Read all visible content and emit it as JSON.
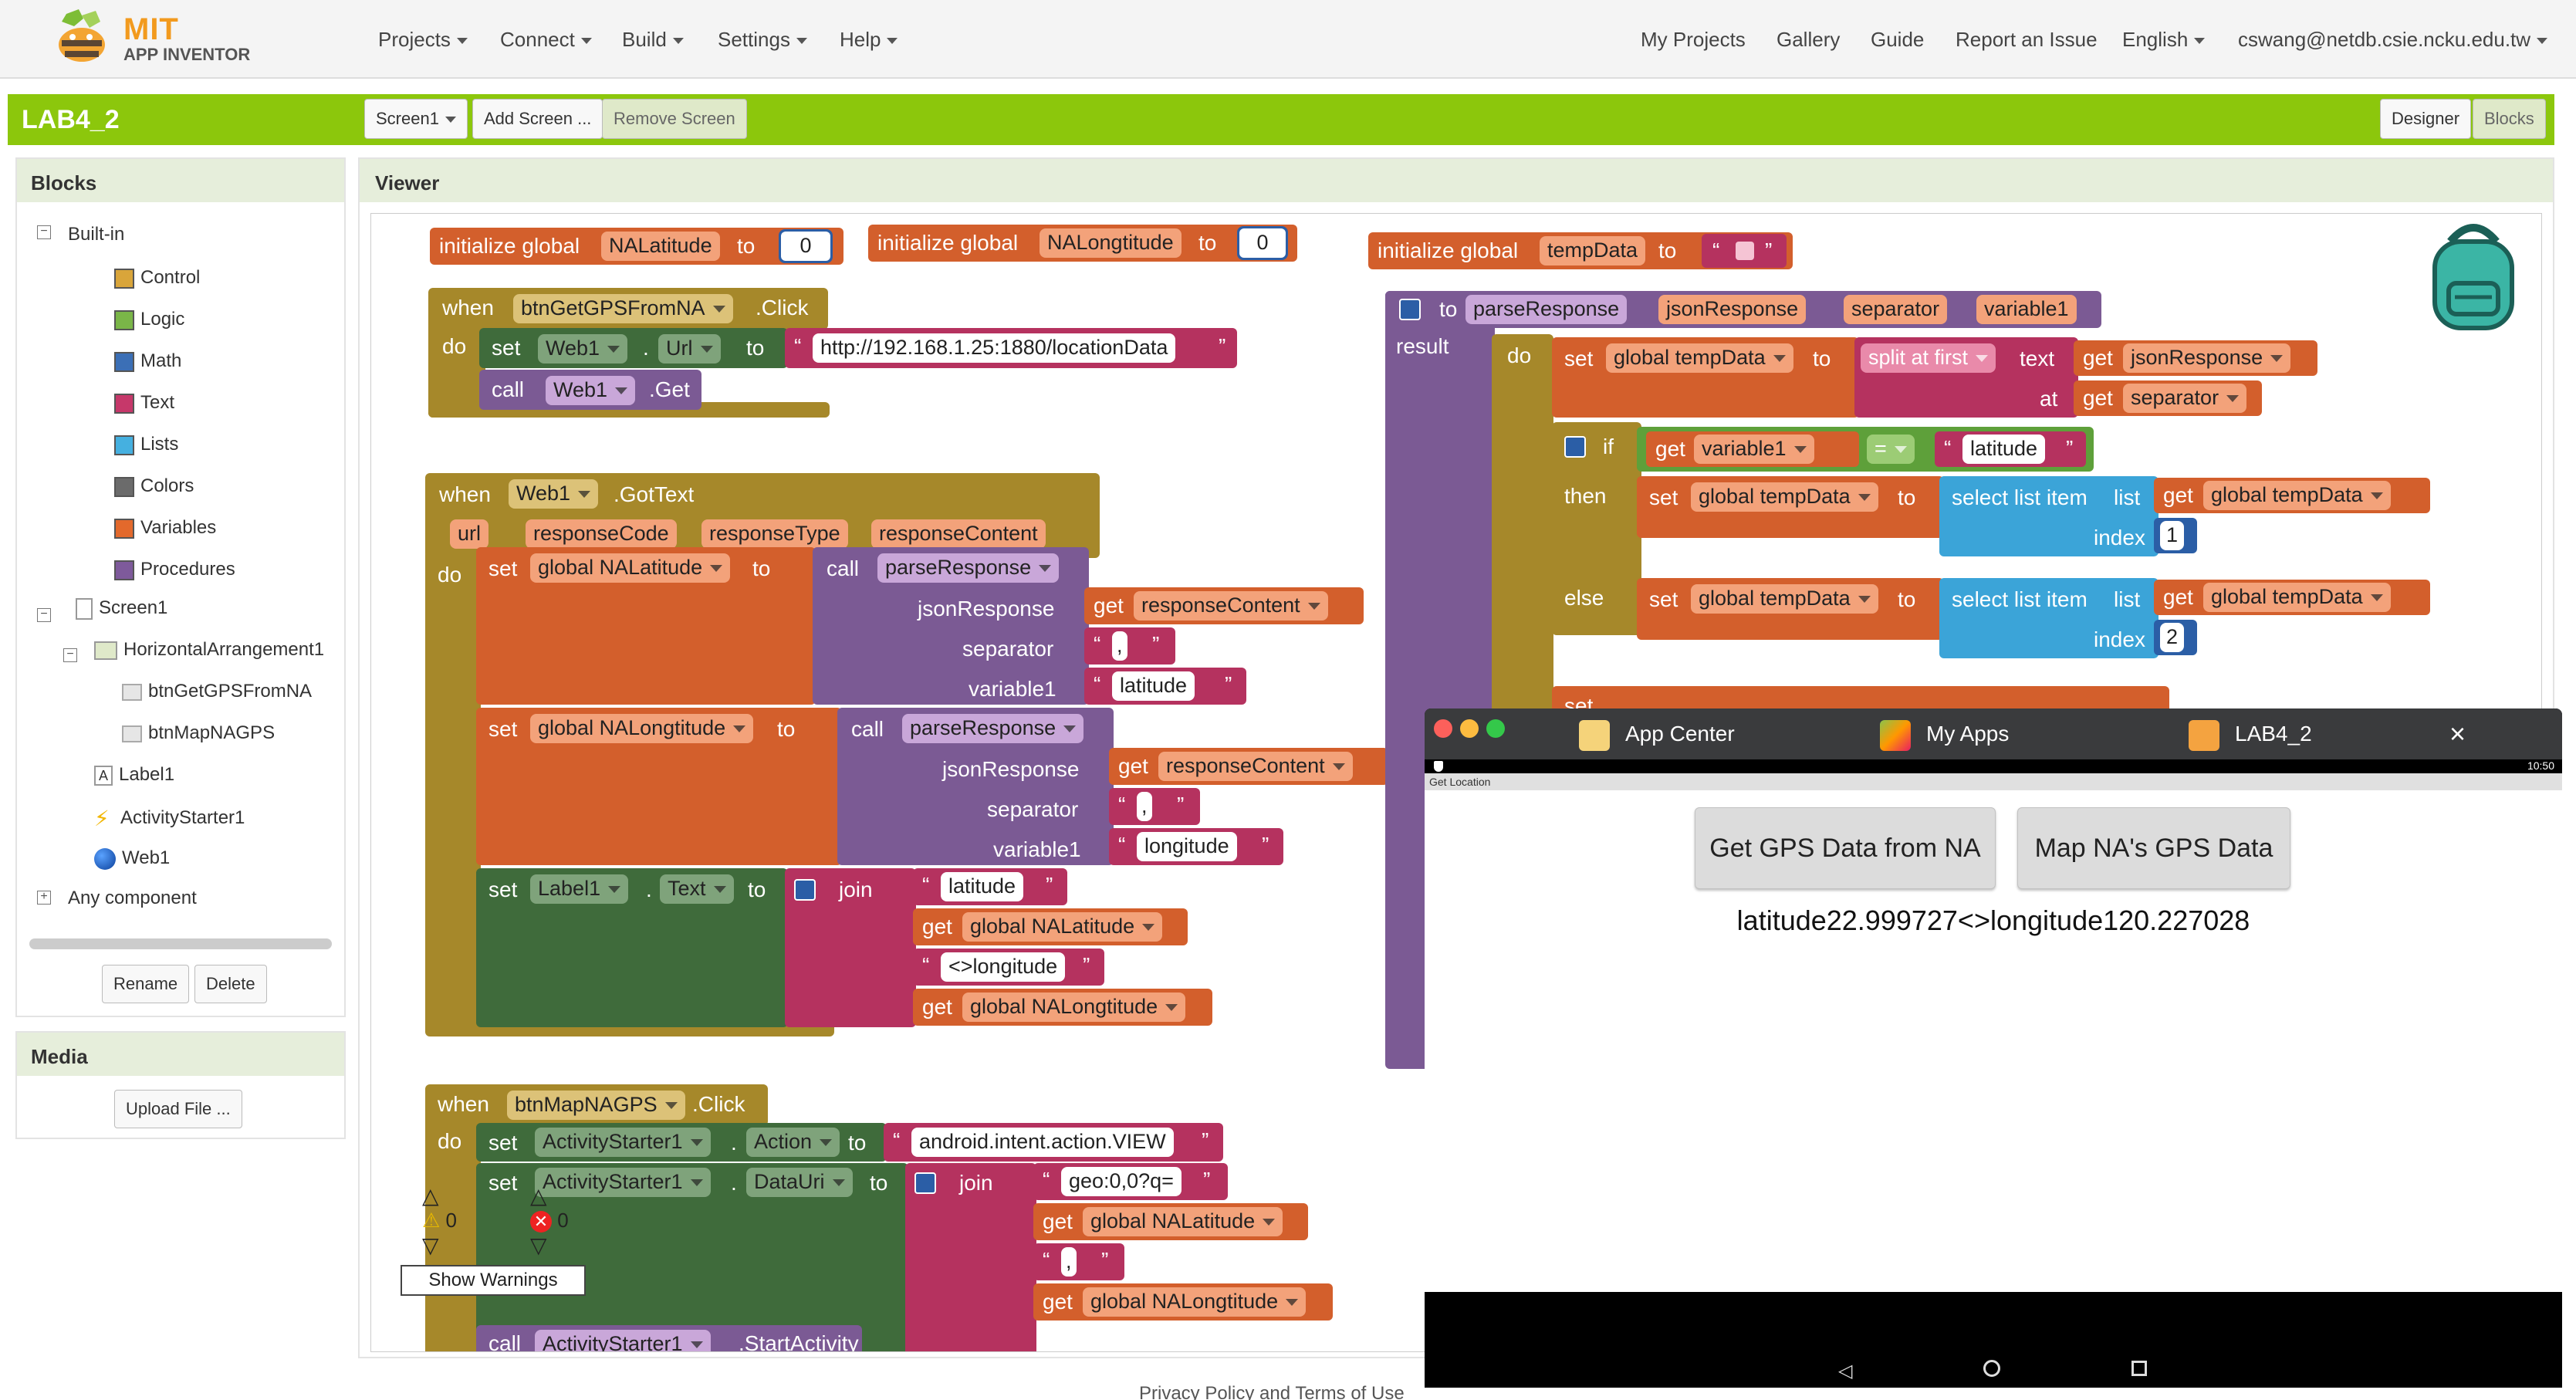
{
  "topnav": {
    "logo_line1": "MIT",
    "logo_line2": "APP INVENTOR",
    "menus": [
      "Projects",
      "Connect",
      "Build",
      "Settings",
      "Help"
    ],
    "right_links": [
      "My Projects",
      "Gallery",
      "Guide",
      "Report an Issue"
    ],
    "language": "English",
    "user": "cswang@netdb.csie.ncku.edu.tw"
  },
  "project": {
    "name": "LAB4_2",
    "screen_select": "Screen1",
    "add_screen": "Add Screen ...",
    "remove_screen": "Remove Screen",
    "designer": "Designer",
    "blocks": "Blocks"
  },
  "blocks_panel": {
    "title": "Blocks",
    "builtin": "Built-in",
    "categories": [
      {
        "label": "Control",
        "color": "#d9a53a"
      },
      {
        "label": "Logic",
        "color": "#7ab648"
      },
      {
        "label": "Math",
        "color": "#3b6fb6"
      },
      {
        "label": "Text",
        "color": "#c6386a"
      },
      {
        "label": "Lists",
        "color": "#45b0e0"
      },
      {
        "label": "Colors",
        "color": "#6b6b6b"
      },
      {
        "label": "Variables",
        "color": "#e3692c"
      },
      {
        "label": "Procedures",
        "color": "#7e5a9b"
      }
    ],
    "screen": "Screen1",
    "arrangement": "HorizontalArrangement1",
    "buttons": [
      "btnGetGPSFromNA",
      "btnMapNAGPS"
    ],
    "label": "Label1",
    "starter": "ActivityStarter1",
    "web": "Web1",
    "any": "Any component",
    "rename": "Rename",
    "delete": "Delete"
  },
  "media": {
    "title": "Media",
    "upload": "Upload File ..."
  },
  "viewer": {
    "title": "Viewer",
    "warnings_count": "0",
    "errors_count": "0",
    "show_warnings": "Show Warnings",
    "footer": "Privacy Policy and Terms of Use"
  },
  "blocks": {
    "init_global": "initialize global",
    "to": "to",
    "var_lat": "NALatitude",
    "var_lng": "NALongtitude",
    "var_temp": "tempData",
    "zero": "0",
    "when": "when",
    "do": "do",
    "set": "set",
    "call": "call",
    "get": "get",
    "btn_gps": "btnGetGPSFromNA",
    "click": ".Click",
    "web1": "Web1",
    "url_prop": "Url",
    "url_value": "http://192.168.1.25:1880/locationData",
    "get_method": ".Get",
    "gottext": ".GotText",
    "params": [
      "url",
      "responseCode",
      "responseType",
      "responseContent"
    ],
    "global_lat": "global NALatitude",
    "global_lng": "global NALongtitude",
    "global_temp": "global tempData",
    "parse": "parseResponse",
    "json_response": "jsonResponse",
    "separator": "separator",
    "variable1": "variable1",
    "response_content": "responseContent",
    "comma": ",",
    "latitude": "latitude",
    "longitude": "longitude",
    "label1": "Label1",
    "text_prop": "Text",
    "join": "join",
    "sep_lng": "<>longitude",
    "btn_map": "btnMapNAGPS",
    "starter": "ActivityStarter1",
    "action_prop": "Action",
    "action_value": "android.intent.action.VIEW",
    "datauri_prop": "DataUri",
    "geo_value": "geo:0,0?q=",
    "start_activity": ".StartActivity",
    "result": "result",
    "split_first": "split at first",
    "text_word": "text",
    "at_word": "at",
    "if_word": "if",
    "then_word": "then",
    "else_word": "else",
    "eq": "=",
    "select_item": "select list item",
    "list_word": "list",
    "index_word": "index",
    "one": "1",
    "two": "2"
  },
  "emulator": {
    "tabs": [
      "App Center",
      "My Apps",
      "LAB4_2"
    ],
    "close": "×",
    "time": "10:50",
    "app_title": "Get Location",
    "btn1": "Get GPS Data from NA",
    "btn2": "Map NA's GPS Data",
    "result": "latitude22.999727<>longitude120.227028"
  }
}
